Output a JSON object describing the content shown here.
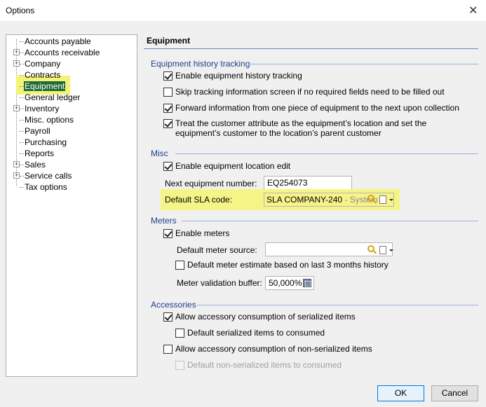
{
  "window": {
    "title": "Options",
    "close_glyph": "✕"
  },
  "tree": {
    "items": [
      {
        "label": "Accounts payable",
        "expandable": false
      },
      {
        "label": "Accounts receivable",
        "expandable": true
      },
      {
        "label": "Company",
        "expandable": true
      },
      {
        "label": "Contracts",
        "expandable": false
      },
      {
        "label": "Equipment",
        "expandable": false,
        "selected": true
      },
      {
        "label": "General ledger",
        "expandable": false
      },
      {
        "label": "Inventory",
        "expandable": true
      },
      {
        "label": "Misc. options",
        "expandable": false
      },
      {
        "label": "Payroll",
        "expandable": false
      },
      {
        "label": "Purchasing",
        "expandable": false
      },
      {
        "label": "Reports",
        "expandable": false
      },
      {
        "label": "Sales",
        "expandable": true
      },
      {
        "label": "Service calls",
        "expandable": true
      },
      {
        "label": "Tax options",
        "expandable": false
      }
    ]
  },
  "panel": {
    "title": "Equipment",
    "history": {
      "title": "Equipment history tracking",
      "enable_label": "Enable equipment history tracking",
      "skip_label": "Skip tracking information screen if no required fields need to be filled out",
      "forward_label": "Forward information from one piece of equipment to the next upon collection",
      "treat_label_1": "Treat the customer attribute as the equipment’s location and set the",
      "treat_label_2": "equipment’s customer to the location’s parent customer"
    },
    "misc": {
      "title": "Misc",
      "enable_location_label": "Enable equipment location edit",
      "next_number_label": "Next equipment number:",
      "next_number_value": "EQ254073",
      "sla_label": "Default SLA code:",
      "sla_value": "SLA COMPANY-240",
      "sla_suffix": " - System (",
      "highlight_color": "#f5f587"
    },
    "meters": {
      "title": "Meters",
      "enable_label": "Enable meters",
      "source_label": "Default meter source:",
      "source_value": "",
      "estimate_label": "Default meter estimate based on last 3 months history",
      "buffer_label": "Meter validation buffer:",
      "buffer_value": "50,000%"
    },
    "accessories": {
      "title": "Accessories",
      "allow_serialized_label": "Allow accessory consumption of serialized items",
      "default_serialized_label": "Default serialized items to consumed",
      "allow_non_serialized_label": "Allow accessory consumption of non-serialized items",
      "default_non_serialized_label": "Default non-serialized items to consumed"
    }
  },
  "buttons": {
    "ok": "OK",
    "cancel": "Cancel"
  },
  "colors": {
    "selection": "#1f6b36",
    "group_title": "#1e3f8c",
    "tree_highlight": "#f3f37a"
  }
}
